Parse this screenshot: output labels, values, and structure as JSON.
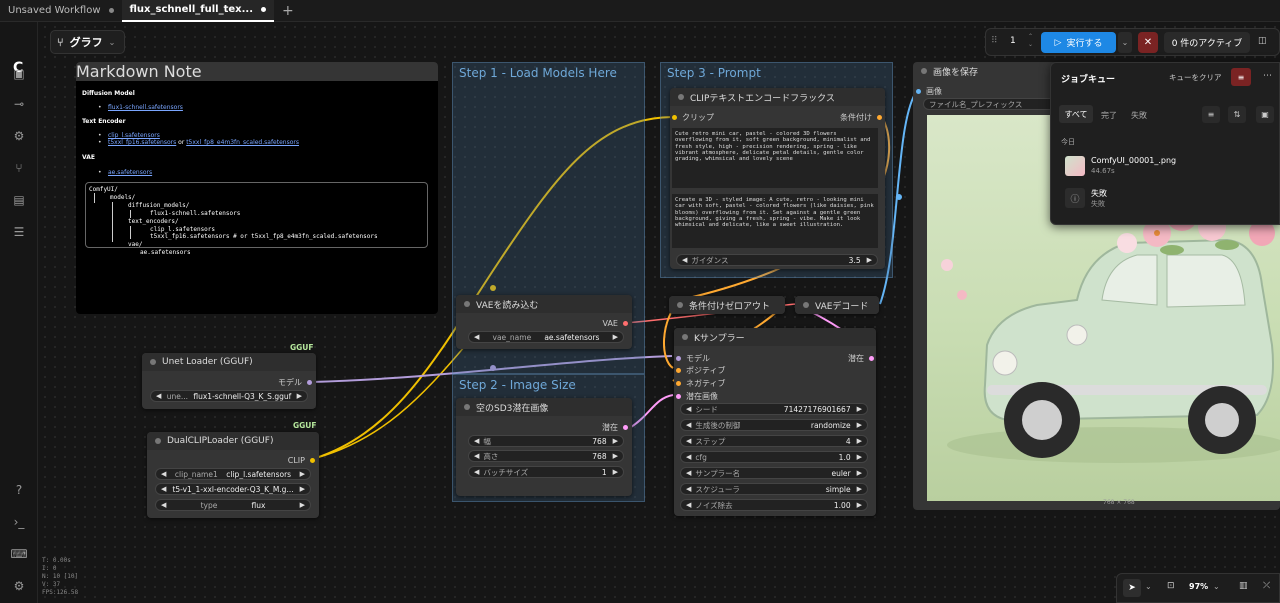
{
  "tabs": [
    {
      "label": "Unsaved Workflow"
    },
    {
      "label": "flux_schnell_full_tex..."
    }
  ],
  "graph_button": {
    "label": "グラフ"
  },
  "stats": [
    "T: 0.00s",
    "I: 0",
    "N: 10 [10]",
    "V: 37",
    "FPS:126.58"
  ],
  "run_toolbar": {
    "count": "1",
    "run_label": "実行する",
    "active_label": "0 件のアクティブ"
  },
  "job_queue": {
    "title": "ジョブキュー",
    "clear_label": "キューをクリア",
    "filters": [
      "すべて",
      "完了",
      "失敗"
    ],
    "section": "今日",
    "items": [
      {
        "title": "ComfyUI_00001_.png",
        "sub": "44.67s"
      },
      {
        "title": "失敗",
        "sub": "失敗"
      }
    ]
  },
  "groups": {
    "step1": "Step 1 - Load Models Here",
    "step2": "Step 2 - Image Size",
    "step3": "Step 3 - Prompt"
  },
  "markdown_note": {
    "title": "Markdown Note",
    "h_diffusion": "Diffusion Model",
    "link_diffusion": "flux1-schnell.safetensors",
    "h_text_encoder": "Text Encoder",
    "link_clip_l": "clip_l.safetensors",
    "link_t5_fp16": "t5xxl_fp16.safetensors",
    "or_text": " or ",
    "link_t5_fp8": "t5xxl_fp8_e4m3fn_scaled.safetensors",
    "h_vae": "VAE",
    "link_vae": "ae.safetensors",
    "tree": [
      "ComfyUI/",
      "models/",
      "diffusion_models/",
      "flux1-schnell.safetensors",
      "text_encoders/",
      "clip_l.safetensors",
      "t5xxl_fp16.safetensors # or t5xxl_fp8_e4m3fn_scaled.safetensors",
      "vae/",
      "ae.safetensors"
    ]
  },
  "unet_loader": {
    "badge": "GGUF",
    "title": "Unet Loader (GGUF)",
    "output": "モデル",
    "widget_label": "une...",
    "widget_value": "flux1-schnell-Q3_K_S.gguf"
  },
  "dual_clip": {
    "badge": "GGUF",
    "title": "DualCLIPLoader (GGUF)",
    "output": "CLIP",
    "w1_label": "clip_name1",
    "w1_value": "clip_l.safetensors",
    "w2_value": "t5-v1_1-xxl-encoder-Q3_K_M.g...",
    "w3_label": "type",
    "w3_value": "flux"
  },
  "vae_loader": {
    "title": "VAEを読み込む",
    "output": "VAE",
    "widget_label": "vae_name",
    "widget_value": "ae.safetensors"
  },
  "empty_latent": {
    "title": "空のSD3潜在画像",
    "output": "潜在",
    "width_label": "幅",
    "width_value": "768",
    "height_label": "高さ",
    "height_value": "768",
    "batch_label": "バッチサイズ",
    "batch_value": "1"
  },
  "clip_encode": {
    "title": "CLIPテキストエンコードフラックス",
    "input": "クリップ",
    "output": "条件付け",
    "text1": "Cute retro mini car, pastel - colored 3D flowers overflowing from it, soft green background, minimalist and fresh style, high - precision rendering, spring - like vibrant atmosphere, delicate petal details, gentle color grading, whimsical and lovely scene",
    "text2": "Create a 3D - styled image: A cute, retro - looking mini car with soft, pastel - colored flowers (like daisies, pink blooms) overflowing from it. Set against a gentle green background, giving a fresh, spring - vibe. Make it look whimsical and delicate, like a sweet illustration.",
    "guidance_label": "ガイダンス",
    "guidance_value": "3.5"
  },
  "zero_out": {
    "title": "条件付けゼロアウト"
  },
  "vae_decode": {
    "title": "VAEデコード"
  },
  "ksampler": {
    "title": "Kサンプラー",
    "inputs": [
      "モデル",
      "ポジティブ",
      "ネガティブ",
      "潜在画像"
    ],
    "output": "潜在",
    "widgets": [
      {
        "label": "シード",
        "value": "714271769016​67"
      },
      {
        "label": "生成後の制御",
        "value": "randomize"
      },
      {
        "label": "ステップ",
        "value": "4"
      },
      {
        "label": "cfg",
        "value": "1.0"
      },
      {
        "label": "サンプラー名",
        "value": "euler"
      },
      {
        "label": "スケジューラ",
        "value": "simple"
      },
      {
        "label": "ノイズ除去",
        "value": "1.00"
      }
    ]
  },
  "save_image": {
    "title": "画像を保存",
    "input": "画像",
    "prefix_label": "ファイル名_プレフィックス",
    "size": "768 × 768"
  },
  "zoom": {
    "value": "97%"
  },
  "colors": {
    "clip_link": "#f0c000",
    "model_link": "#b39ddb",
    "vae_link": "#ff6e6e",
    "latent_link": "#ff9cf9",
    "cond_link": "#ffa931",
    "image_link": "#64b5f6",
    "run_button": "#1e88e5",
    "group": "#3f789e"
  }
}
